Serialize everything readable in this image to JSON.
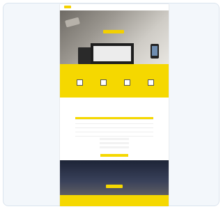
{
  "nav": {
    "brand": "",
    "links": ""
  },
  "hero": {
    "title": "",
    "button": ""
  },
  "features": {
    "title": "",
    "subtitle": "",
    "items": [
      {
        "icon": "phone-icon",
        "label": ""
      },
      {
        "icon": "calendar-icon",
        "label": ""
      },
      {
        "icon": "photo-icon",
        "label": ""
      },
      {
        "icon": "tablet-icon",
        "label": ""
      }
    ]
  },
  "pricing": {
    "title": "",
    "description": "",
    "rows": [
      {
        "name": "",
        "a": "",
        "b": ""
      },
      {
        "name": "",
        "a": "",
        "b": ""
      },
      {
        "name": "",
        "a": "",
        "b": ""
      },
      {
        "name": "",
        "a": "",
        "b": ""
      }
    ],
    "button": ""
  },
  "cta": {
    "title": "",
    "subtitle": "",
    "button": ""
  },
  "footer": {
    "title": "",
    "subtitle": ""
  },
  "colors": {
    "accent": "#f5d800",
    "dark": "#1d2437"
  }
}
